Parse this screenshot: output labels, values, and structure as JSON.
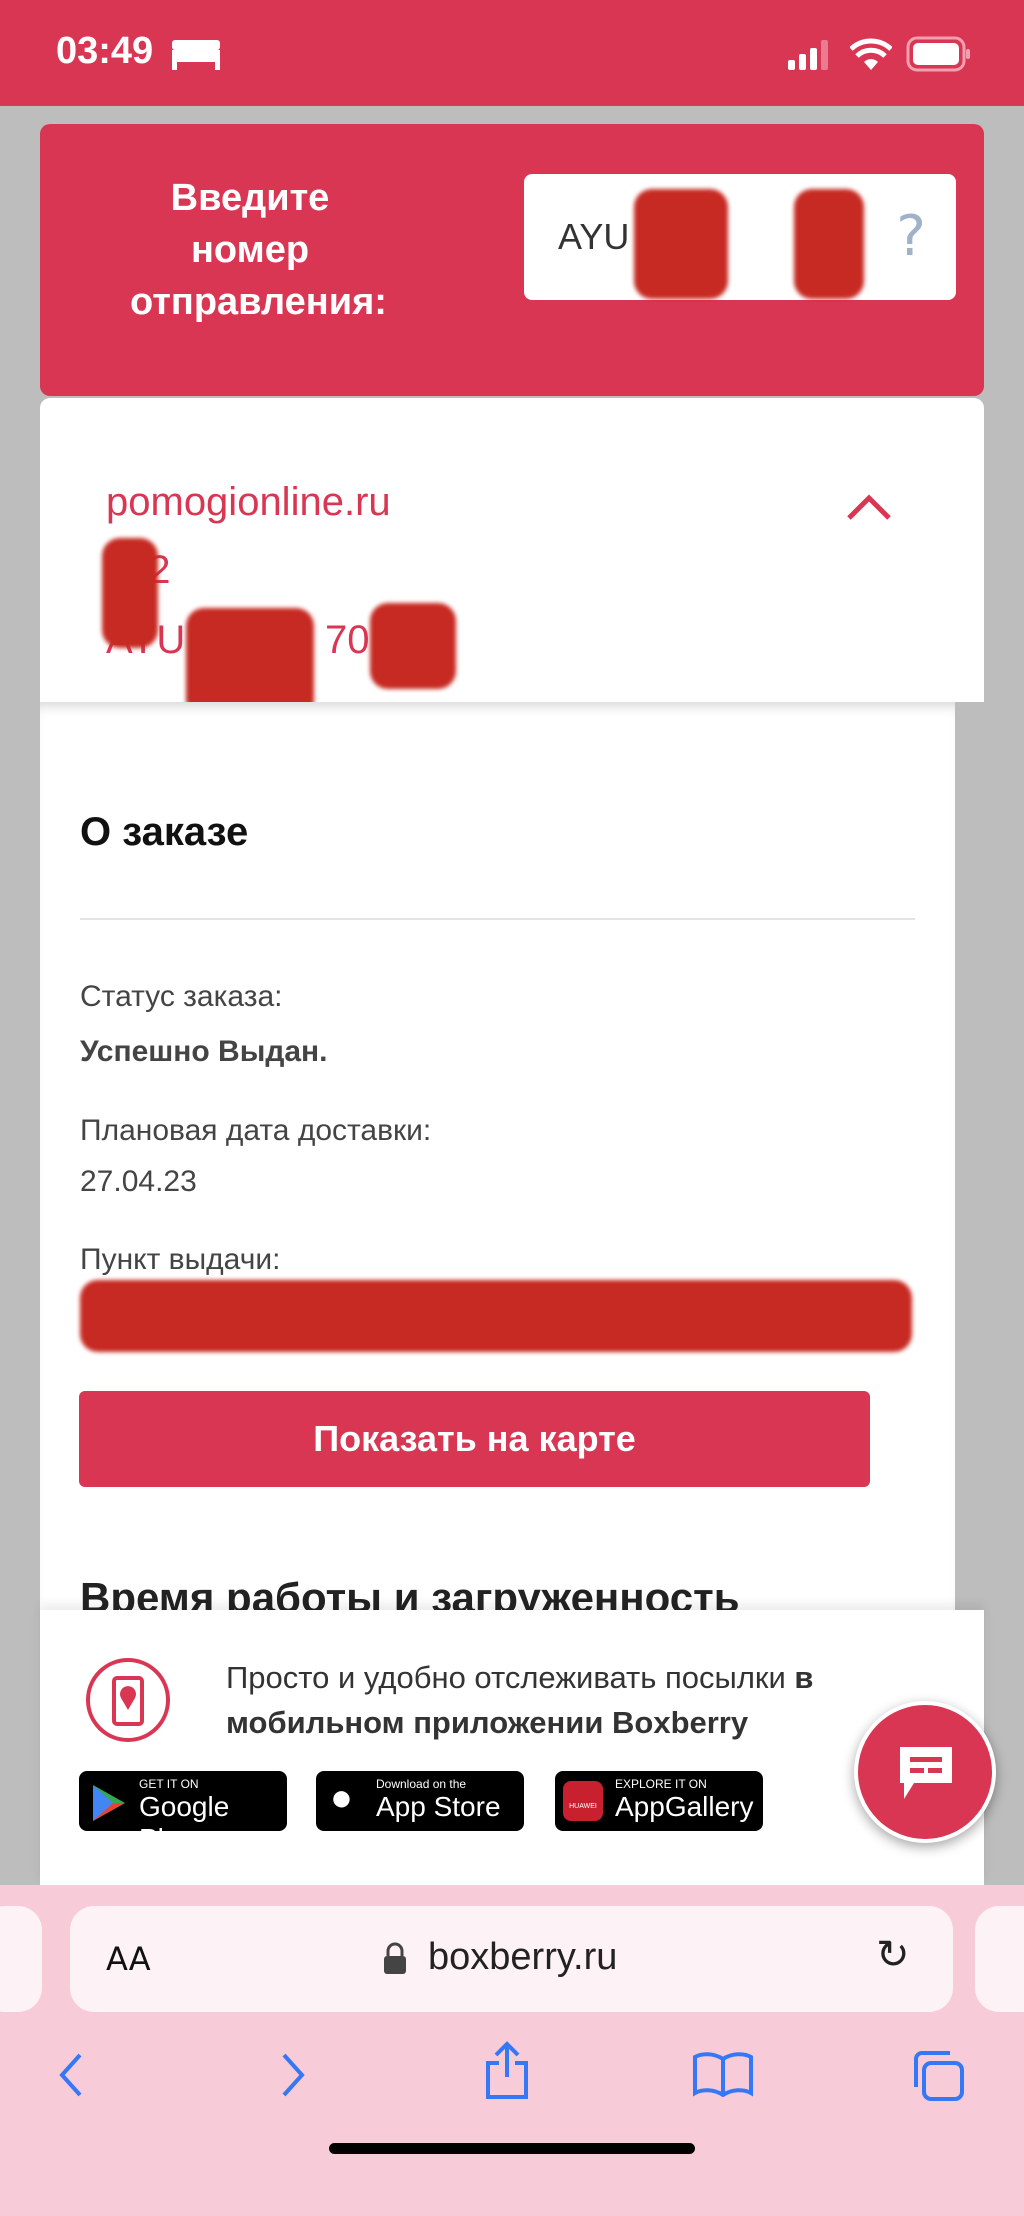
{
  "status_bar": {
    "time": "03:49",
    "sleep_icon": "bed-icon",
    "signal_icon": "cellular-signal-icon",
    "wifi_icon": "wifi-icon",
    "battery_icon": "battery-icon"
  },
  "search": {
    "prompt": "Введите номер отправления:",
    "value": "AYU 070",
    "help": "?"
  },
  "shipment": {
    "sender": "pomogionline.ru",
    "id_partial": "72",
    "tracking_partial_start": "AYU",
    "tracking_partial_end": "70"
  },
  "order": {
    "title": "О заказе",
    "status_label": "Статус заказа:",
    "status_value": "Успешно Выдан.",
    "date_label": "Плановая дата доставки:",
    "date_value": "27.04.23",
    "pickup_label": "Пункт выдачи:",
    "map_button": "Показать на карте",
    "hours_title": "Время работы и загруженность"
  },
  "banner": {
    "text": "Просто и удобно отслеживать посылки ",
    "text_bold": "в мобильном приложении Boxberry",
    "google_small": "GET IT ON",
    "google_big": "Google Play",
    "apple_small": "Download on the",
    "apple_big": "App Store",
    "huawei_small": "EXPLORE IT ON",
    "huawei_big": "AppGallery",
    "huawei_brand": "HUAWEI"
  },
  "safari": {
    "aa": "AA",
    "url": "boxberry.ru"
  },
  "colors": {
    "brand": "#d93654",
    "safari_bar": "#f7cbd8"
  }
}
